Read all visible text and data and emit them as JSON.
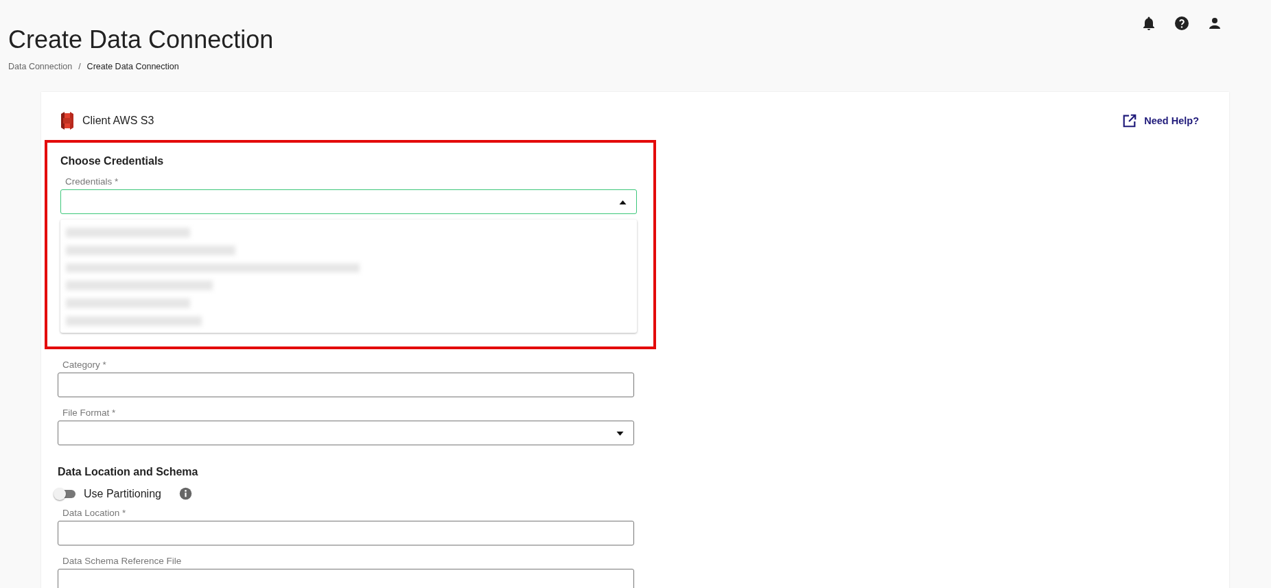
{
  "page": {
    "title": "Create Data Connection"
  },
  "breadcrumb_separator": "/",
  "breadcrumbs": [
    {
      "label": "Data Connection",
      "current": false
    },
    {
      "label": "Create Data Connection",
      "current": true
    }
  ],
  "header_icons": [
    {
      "kind": "bell"
    },
    {
      "kind": "help"
    },
    {
      "kind": "user"
    }
  ],
  "card": {
    "connector": "Client AWS S3",
    "help_link": "Need Help?"
  },
  "credentials_section": {
    "heading": "Choose Credentials",
    "highlighted": true,
    "field": {
      "label": "Credentials *",
      "expanded": true,
      "focused": true
    },
    "options": [
      {
        "kind": "redacted"
      },
      {
        "kind": "redacted"
      },
      {
        "kind": "redacted"
      },
      {
        "kind": "redacted"
      },
      {
        "kind": "redacted"
      },
      {
        "kind": "redacted"
      }
    ]
  },
  "fields_top": [
    {
      "label": "Category *",
      "kind": "text"
    },
    {
      "label": "File Format *",
      "kind": "select",
      "expanded": false
    }
  ],
  "location_section": {
    "heading": "Data Location and Schema",
    "toggle": {
      "label": "Use Partitioning",
      "on": false
    },
    "fields": [
      {
        "label": "Data Location *"
      },
      {
        "label": "Data Schema Reference File"
      }
    ]
  }
}
